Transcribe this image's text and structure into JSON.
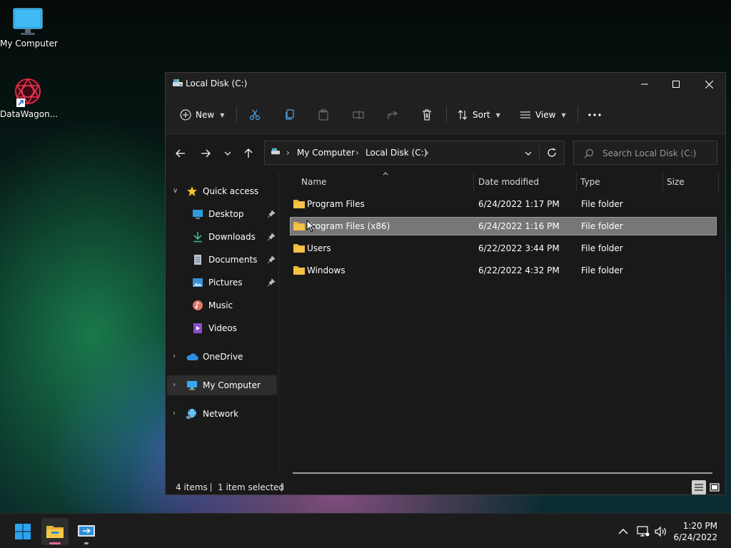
{
  "desktop": {
    "icons": [
      {
        "label": "My Computer",
        "icon": "monitor-icon"
      },
      {
        "label": "DataWagon...",
        "icon": "datawagon-shortcut-icon"
      }
    ]
  },
  "window": {
    "title": "Local Disk (C:)",
    "controls": [
      "minimize",
      "maximize",
      "close"
    ]
  },
  "toolbar": {
    "new_label": "New",
    "sort_label": "Sort",
    "view_label": "View",
    "more_label": "..."
  },
  "address": {
    "crumbs": [
      "My Computer",
      "Local Disk (C:)"
    ],
    "search_placeholder": "Search Local Disk (C:)"
  },
  "sidebar": {
    "quick_access": "Quick access",
    "items": [
      {
        "label": "Desktop",
        "icon": "desktop-icon",
        "pinned": true
      },
      {
        "label": "Downloads",
        "icon": "downloads-icon",
        "pinned": true
      },
      {
        "label": "Documents",
        "icon": "documents-icon",
        "pinned": true
      },
      {
        "label": "Pictures",
        "icon": "pictures-icon",
        "pinned": true
      },
      {
        "label": "Music",
        "icon": "music-icon",
        "pinned": false
      },
      {
        "label": "Videos",
        "icon": "videos-icon",
        "pinned": false
      }
    ],
    "onedrive": "OneDrive",
    "my_computer": "My Computer",
    "network": "Network"
  },
  "columns": {
    "name": "Name",
    "date": "Date modified",
    "type": "Type",
    "size": "Size"
  },
  "files": [
    {
      "name": "Program Files",
      "date": "6/24/2022 1:17 PM",
      "type": "File folder",
      "size": "",
      "selected": false
    },
    {
      "name": "Program Files (x86)",
      "date": "6/24/2022 1:16 PM",
      "type": "File folder",
      "size": "",
      "selected": true
    },
    {
      "name": "Users",
      "date": "6/22/2022 3:44 PM",
      "type": "File folder",
      "size": "",
      "selected": false
    },
    {
      "name": "Windows",
      "date": "6/22/2022 4:32 PM",
      "type": "File folder",
      "size": "",
      "selected": false
    }
  ],
  "status": {
    "count": "4 items",
    "selection": "1 item selected"
  },
  "taskbar": {
    "time": "1:20 PM",
    "date": "6/24/2022"
  },
  "colors": {
    "window_bg": "#191919",
    "selection": "#777777",
    "folder": "#f5c243",
    "accent": "#0078d4"
  }
}
